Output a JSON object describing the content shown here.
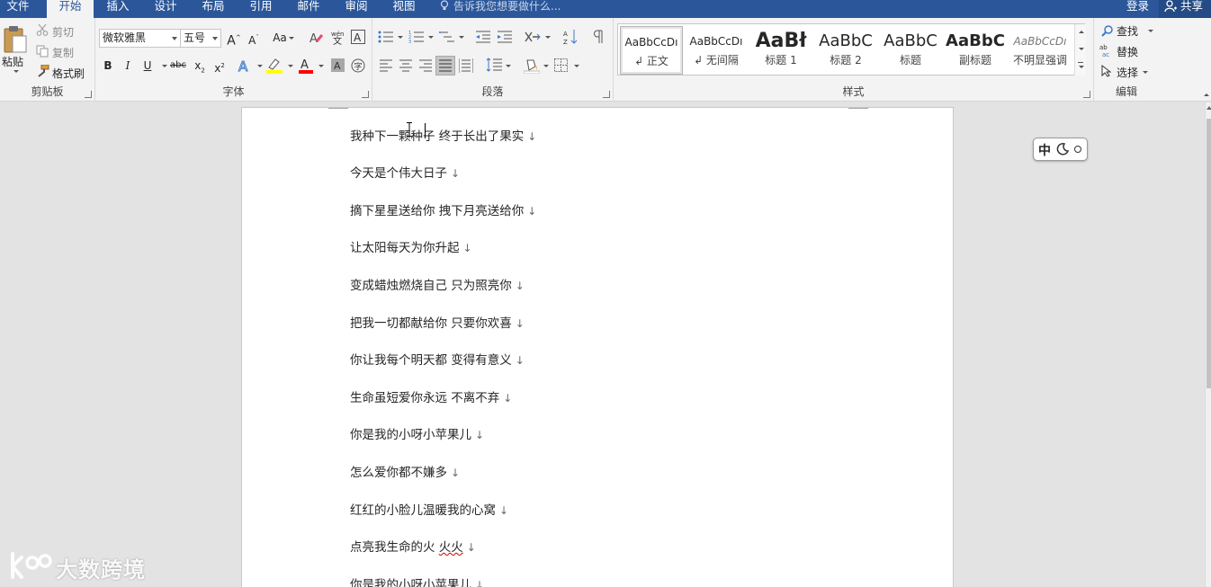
{
  "tabs": [
    {
      "label": "文件"
    },
    {
      "label": "开始"
    },
    {
      "label": "插入"
    },
    {
      "label": "设计"
    },
    {
      "label": "布局"
    },
    {
      "label": "引用"
    },
    {
      "label": "邮件"
    },
    {
      "label": "审阅"
    },
    {
      "label": "视图"
    }
  ],
  "tell_me": "告诉我您想要做什么...",
  "account": {
    "login": "登录",
    "share": "共享"
  },
  "clipboard": {
    "paste": "粘贴",
    "cut": "剪切",
    "copy": "复制",
    "format_painter": "格式刷",
    "group_label": "剪贴板"
  },
  "font": {
    "name": "微软雅黑",
    "size": "五号",
    "change_case": "Aa",
    "group_label": "字体"
  },
  "paragraph": {
    "group_label": "段落"
  },
  "styles": {
    "items": [
      {
        "sample": "AaBbCcDı",
        "name": "↲ 正文"
      },
      {
        "sample": "AaBbCcDı",
        "name": "↲ 无间隔"
      },
      {
        "sample": "AaBł",
        "name": "标题 1"
      },
      {
        "sample": "AaBbC",
        "name": "标题 2"
      },
      {
        "sample": "AaBbC",
        "name": "标题"
      },
      {
        "sample": "AaBbC",
        "name": "副标题"
      },
      {
        "sample": "AaBbCcDı",
        "name": "不明显强调"
      }
    ],
    "group_label": "样式"
  },
  "editing": {
    "find": "查找",
    "replace": "替换",
    "select": "选择",
    "group_label": "编辑"
  },
  "document": {
    "paragraphs": [
      {
        "text": "我种下一颗种子 终于长出了果实"
      },
      {
        "text": "今天是个伟大日子"
      },
      {
        "text": "摘下星星送给你 拽下月亮送给你"
      },
      {
        "text": "让太阳每天为你升起"
      },
      {
        "text": "变成蜡烛燃烧自己 只为照亮你"
      },
      {
        "text": "把我一切都献给你 只要你欢喜"
      },
      {
        "text": "你让我每个明天都 变得有意义"
      },
      {
        "text": "生命虽短爱你永远 不离不弃"
      },
      {
        "text": "你是我的小呀小苹果儿"
      },
      {
        "text": "怎么爱你都不嫌多"
      },
      {
        "text": "红红的小脸儿温暖我的心窝"
      },
      {
        "text": "点亮我生命的火 ",
        "flagged": "火火"
      },
      {
        "text": "你是我的小呀小苹果儿"
      }
    ],
    "para_mark": "↓"
  },
  "ime": {
    "mode": "中"
  },
  "watermark": "大数跨境"
}
